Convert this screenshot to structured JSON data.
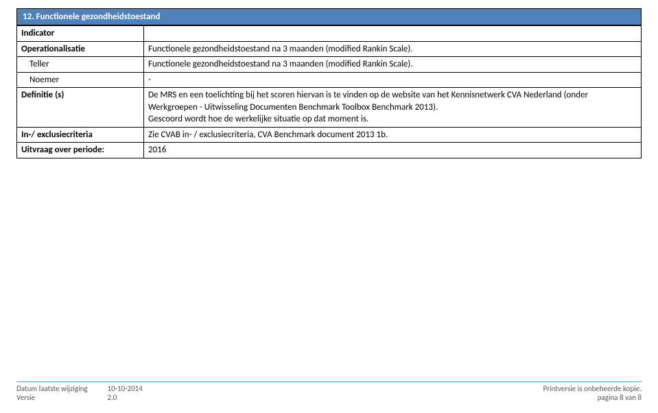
{
  "section": {
    "title": "12. Functionele gezondheidstoestand"
  },
  "rows": {
    "indicator_label": "Indicator",
    "indicator_value": "",
    "operationalisatie_label": "Operationalisatie",
    "operationalisatie_value": "Functionele gezondheidstoestand na 3 maanden (modified Rankin Scale).",
    "teller_label": "Teller",
    "teller_value": "Functionele gezondheidstoestand na 3 maanden (modified Rankin Scale).",
    "noemer_label": "Noemer",
    "noemer_value": "-",
    "definitie_label": "Definitie (s)",
    "definitie_value": "De MRS en een toelichting bij het scoren hiervan is te vinden op de website van het Kennisnetwerk CVA Nederland (onder Werkgroepen - Uitwisseling Documenten Benchmark Toolbox Benchmark 2013).\nGescoord wordt hoe de werkelijke situatie op dat moment is.",
    "inexcl_label": "In-/ exclusiecriteria",
    "inexcl_value": "Zie CVAB in- / exclusiecriteria, CVA Benchmark document 2013 1b.",
    "uitvraag_label": "Uitvraag over periode:",
    "uitvraag_value": "2016"
  },
  "footer": {
    "datum_label": "Datum laatste wijziging",
    "datum_value": "10-10-2014",
    "versie_label": "Versie",
    "versie_value": "2.0",
    "warn": "Printversie is onbeheerde kopie.",
    "page": "pagina 8 van 8"
  }
}
